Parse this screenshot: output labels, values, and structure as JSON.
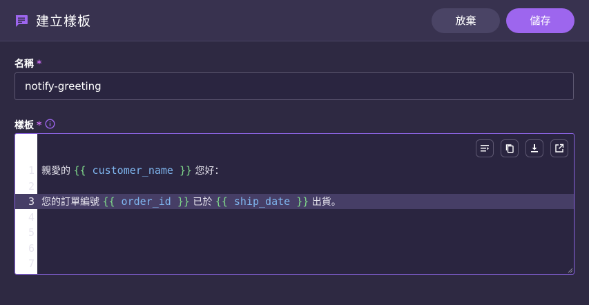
{
  "header": {
    "title": "建立樣板",
    "cancel_label": "放棄",
    "save_label": "儲存",
    "icon": "template-icon",
    "accent": "#9d66ee"
  },
  "form": {
    "name": {
      "label": "名稱",
      "required_mark": "*",
      "value": "notify-greeting"
    },
    "template": {
      "label": "樣板",
      "required_mark": "*",
      "info_icon": "info-icon",
      "toolbar": [
        "wrap-icon",
        "copy-icon",
        "download-icon",
        "open-external-icon"
      ],
      "active_line": 3,
      "lines": [
        {
          "num": "1",
          "segments": [
            {
              "type": "text",
              "text": "親愛的 "
            },
            {
              "type": "brace",
              "text": "{{"
            },
            {
              "type": "var",
              "text": " customer_name "
            },
            {
              "type": "brace",
              "text": "}}"
            },
            {
              "type": "text",
              "text": " 您好："
            }
          ]
        },
        {
          "num": "2",
          "segments": []
        },
        {
          "num": "3",
          "segments": [
            {
              "type": "text",
              "text": "您的訂單編號 "
            },
            {
              "type": "brace",
              "text": "{{"
            },
            {
              "type": "var",
              "text": " order_id "
            },
            {
              "type": "brace",
              "text": "}}"
            },
            {
              "type": "text",
              "text": " 已於 "
            },
            {
              "type": "brace",
              "text": "{{"
            },
            {
              "type": "var",
              "text": " ship_date "
            },
            {
              "type": "brace",
              "text": "}}"
            },
            {
              "type": "text",
              "text": " 出貨。"
            }
          ]
        },
        {
          "num": "4",
          "segments": []
        },
        {
          "num": "5",
          "segments": []
        },
        {
          "num": "6",
          "segments": []
        },
        {
          "num": "7",
          "segments": []
        }
      ]
    }
  }
}
